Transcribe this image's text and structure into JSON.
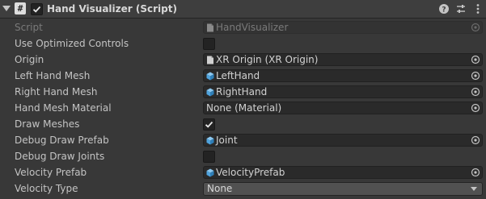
{
  "header": {
    "title": "Hand Visualizer (Script)",
    "enabled": true,
    "icons": [
      "fold-arrow-icon",
      "script-icon",
      "help-icon",
      "preset-icon",
      "menu-icon"
    ]
  },
  "properties": [
    {
      "label": "Script",
      "type": "object",
      "value": "HandVisualizer",
      "icon": "script-file-icon",
      "disabled": true
    },
    {
      "label": "Use Optimized Controls",
      "type": "checkbox",
      "checked": false
    },
    {
      "label": "Origin",
      "type": "object",
      "value": "XR Origin (XR Origin)",
      "icon": "script-file-icon"
    },
    {
      "label": "Left Hand Mesh",
      "type": "object",
      "value": "LeftHand",
      "icon": "prefab-icon"
    },
    {
      "label": "Right Hand Mesh",
      "type": "object",
      "value": "RightHand",
      "icon": "prefab-icon"
    },
    {
      "label": "Hand Mesh Material",
      "type": "object",
      "value": "None (Material)",
      "icon": ""
    },
    {
      "label": "Draw Meshes",
      "type": "checkbox",
      "checked": true
    },
    {
      "label": "Debug Draw Prefab",
      "type": "object",
      "value": "Joint",
      "icon": "prefab-icon"
    },
    {
      "label": "Debug Draw Joints",
      "type": "checkbox",
      "checked": false
    },
    {
      "label": "Velocity Prefab",
      "type": "object",
      "value": "VelocityPrefab",
      "icon": "prefab-icon"
    },
    {
      "label": "Velocity Type",
      "type": "dropdown",
      "value": "None"
    }
  ],
  "colors": {
    "background": "#383838",
    "header": "#3e3e3e",
    "field": "#2a2a2a",
    "prefab_icon": "#4fa3dd",
    "text": "#c4c4c4"
  }
}
